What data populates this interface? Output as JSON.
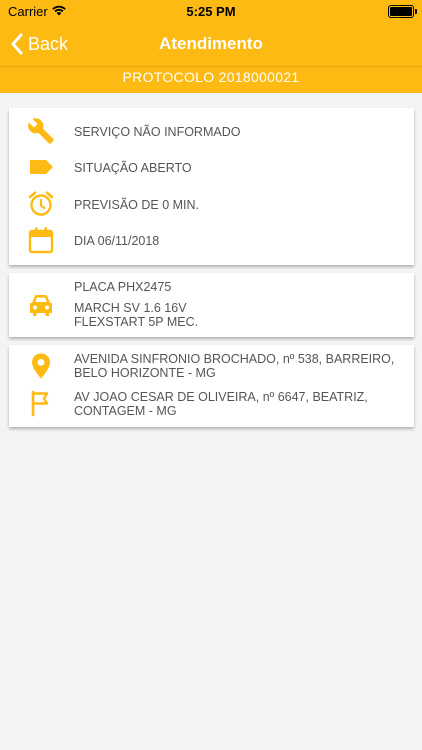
{
  "status_bar": {
    "carrier": "Carrier",
    "time": "5:25 PM"
  },
  "nav": {
    "back_label": "Back",
    "title": "Atendimento"
  },
  "protocol": "PROTOCOLO 2018000021",
  "service_card": {
    "service": "SERVIÇO NÃO INFORMADO",
    "situation": "SITUAÇÃO ABERTO",
    "forecast": "PREVISÃO DE 0 MIN.",
    "date": "DIA 06/11/2018"
  },
  "vehicle_card": {
    "plate": "PLACA PHX2475",
    "model_line1": "MARCH SV 1.6 16V",
    "model_line2": "FLEXSTART 5P MEC."
  },
  "address_card": {
    "origin_line1": "AVENIDA SINFRONIO BROCHADO, nº 538, BARREIRO,",
    "origin_line2": "BELO HORIZONTE - MG",
    "destination_line1": "AV JOAO CESAR DE OLIVEIRA, nº 6647, BEATRIZ,",
    "destination_line2": "CONTAGEM - MG"
  },
  "colors": {
    "accent": "#fcba13",
    "background": "#f4f4f4",
    "text": "#555555"
  }
}
